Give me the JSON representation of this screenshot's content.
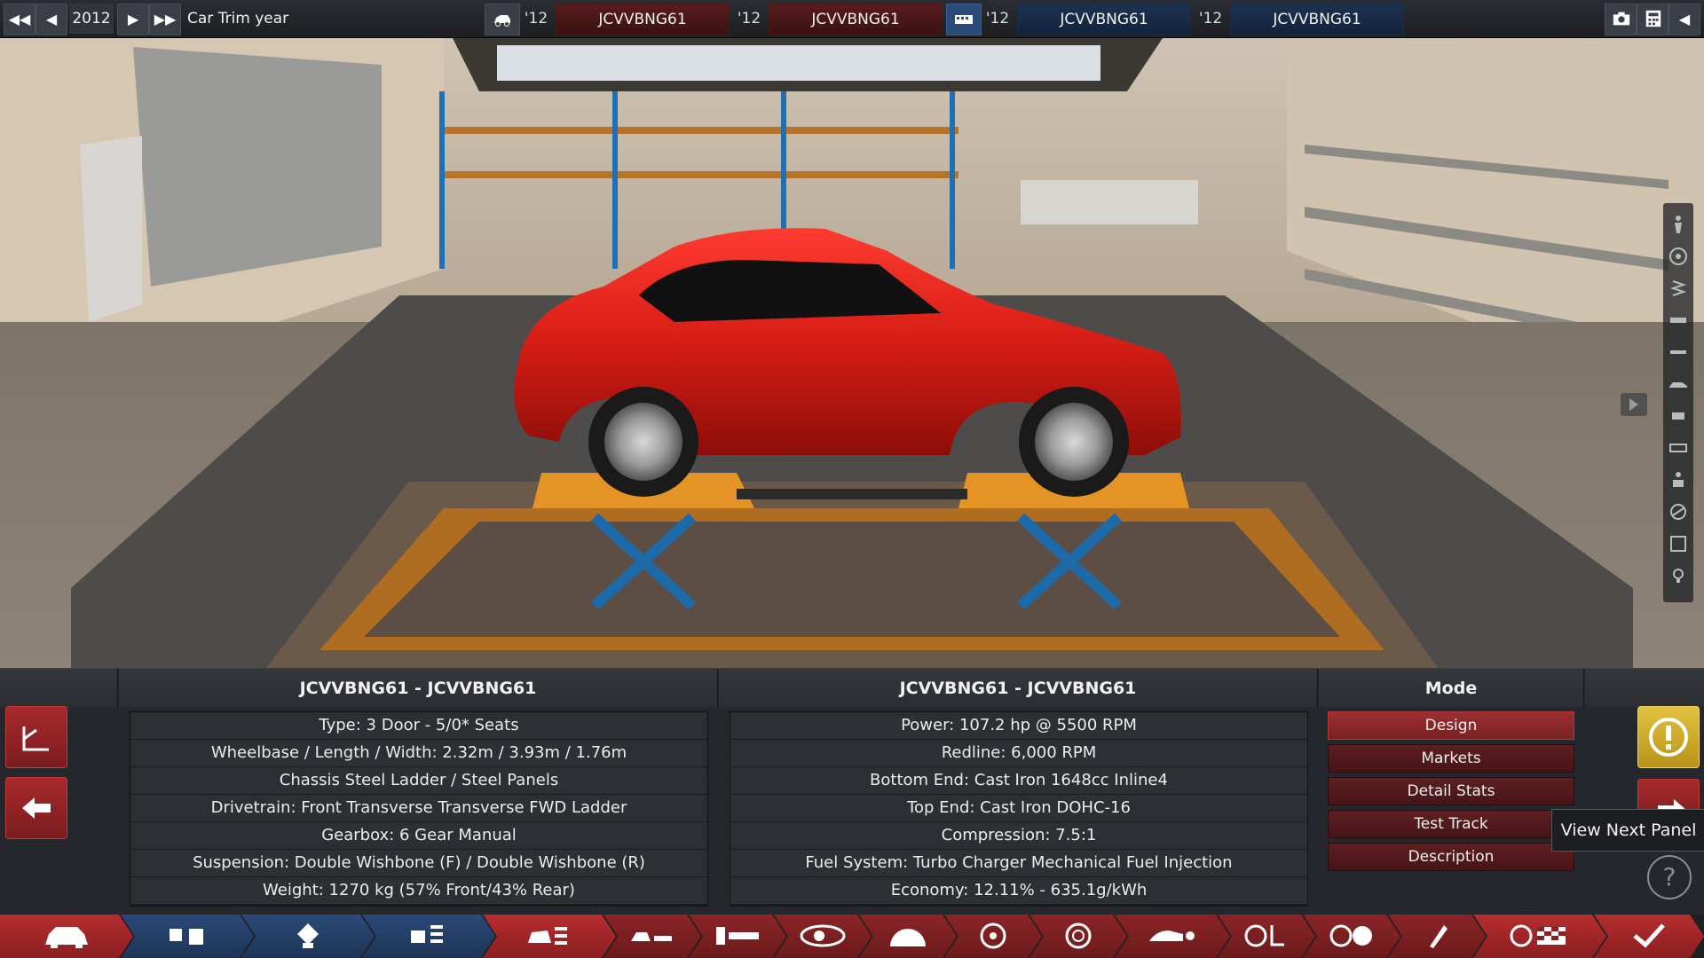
{
  "topbar": {
    "year": "2012",
    "trim_year_label": "Car Trim year",
    "slots": [
      {
        "year": "'12",
        "name": "JCVVBNG61"
      },
      {
        "year": "'12",
        "name": "JCVVBNG61"
      },
      {
        "year": "'12",
        "name": "JCVVBNG61"
      },
      {
        "year": "'12",
        "name": "JCVVBNG61"
      }
    ],
    "icons": [
      "first-icon",
      "prev-icon",
      "next-icon",
      "last-icon",
      "car-body-icon",
      "engine-icon",
      "camera-icon",
      "calculator-icon",
      "exit-icon"
    ]
  },
  "side_tools": [
    "person-icon",
    "wheel-icon",
    "spring-icon",
    "brake-icon",
    "bumper-icon",
    "car-side-icon",
    "seat-icon",
    "grille-icon",
    "driver-icon",
    "steering-icon",
    "trim-icon",
    "light-icon"
  ],
  "panel": {
    "car_column": {
      "title": "JCVVBNG61 - JCVVBNG61",
      "rows": [
        "Type: 3 Door - 5/0* Seats",
        "Wheelbase / Length / Width: 2.32m / 3.93m / 1.76m",
        "Chassis Steel Ladder / Steel Panels",
        "Drivetrain: Front Transverse Transverse FWD Ladder",
        "Gearbox: 6 Gear Manual",
        "Suspension: Double Wishbone (F) / Double Wishbone (R)",
        "Weight: 1270 kg (57% Front/43% Rear)"
      ]
    },
    "engine_column": {
      "title": "JCVVBNG61 - JCVVBNG61",
      "rows": [
        "Power: 107.2 hp @ 5500 RPM",
        "Redline:  6,000 RPM",
        "Bottom End: Cast Iron 1648cc Inline4",
        "Top End: Cast Iron DOHC-16",
        "Compression: 7.5:1",
        "Fuel System: Turbo Charger Mechanical Fuel Injection",
        "Economy: 12.11% - 635.1g/kWh"
      ]
    },
    "mode": {
      "title": "Mode",
      "buttons": [
        "Design",
        "Markets",
        "Detail Stats",
        "Test Track",
        "Description"
      ],
      "active": "Design"
    },
    "tooltip": "View Next Panel",
    "help": "?"
  },
  "tabs": [
    "car-body-tab",
    "engine-parts-tab",
    "engine-design-tab",
    "engine-tuning-tab",
    "car-overview-tab",
    "chassis-tab",
    "suspension-tab",
    "drivetrain-tab",
    "gearbox-tab",
    "wheels-tab",
    "brakes-tab",
    "body-tab",
    "interior-tab",
    "steering-tab",
    "paint-tab",
    "testing-tab",
    "finish-tab"
  ]
}
